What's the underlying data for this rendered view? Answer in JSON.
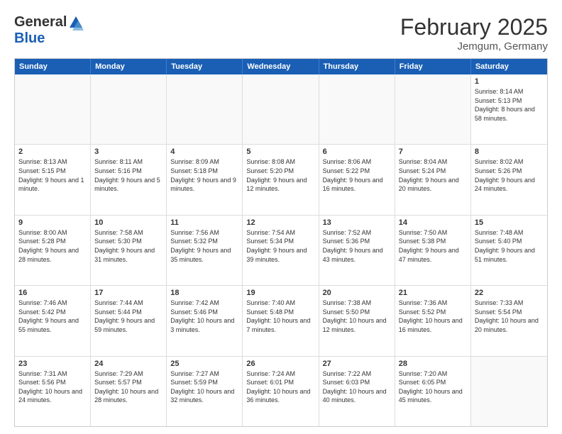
{
  "header": {
    "logo_general": "General",
    "logo_blue": "Blue",
    "month_title": "February 2025",
    "location": "Jemgum, Germany"
  },
  "days_of_week": [
    "Sunday",
    "Monday",
    "Tuesday",
    "Wednesday",
    "Thursday",
    "Friday",
    "Saturday"
  ],
  "weeks": [
    {
      "cells": [
        {
          "day": null,
          "content": ""
        },
        {
          "day": null,
          "content": ""
        },
        {
          "day": null,
          "content": ""
        },
        {
          "day": null,
          "content": ""
        },
        {
          "day": null,
          "content": ""
        },
        {
          "day": null,
          "content": ""
        },
        {
          "day": "1",
          "content": "Sunrise: 8:14 AM\nSunset: 5:13 PM\nDaylight: 8 hours and 58 minutes."
        }
      ]
    },
    {
      "cells": [
        {
          "day": "2",
          "content": "Sunrise: 8:13 AM\nSunset: 5:15 PM\nDaylight: 9 hours and 1 minute."
        },
        {
          "day": "3",
          "content": "Sunrise: 8:11 AM\nSunset: 5:16 PM\nDaylight: 9 hours and 5 minutes."
        },
        {
          "day": "4",
          "content": "Sunrise: 8:09 AM\nSunset: 5:18 PM\nDaylight: 9 hours and 9 minutes."
        },
        {
          "day": "5",
          "content": "Sunrise: 8:08 AM\nSunset: 5:20 PM\nDaylight: 9 hours and 12 minutes."
        },
        {
          "day": "6",
          "content": "Sunrise: 8:06 AM\nSunset: 5:22 PM\nDaylight: 9 hours and 16 minutes."
        },
        {
          "day": "7",
          "content": "Sunrise: 8:04 AM\nSunset: 5:24 PM\nDaylight: 9 hours and 20 minutes."
        },
        {
          "day": "8",
          "content": "Sunrise: 8:02 AM\nSunset: 5:26 PM\nDaylight: 9 hours and 24 minutes."
        }
      ]
    },
    {
      "cells": [
        {
          "day": "9",
          "content": "Sunrise: 8:00 AM\nSunset: 5:28 PM\nDaylight: 9 hours and 28 minutes."
        },
        {
          "day": "10",
          "content": "Sunrise: 7:58 AM\nSunset: 5:30 PM\nDaylight: 9 hours and 31 minutes."
        },
        {
          "day": "11",
          "content": "Sunrise: 7:56 AM\nSunset: 5:32 PM\nDaylight: 9 hours and 35 minutes."
        },
        {
          "day": "12",
          "content": "Sunrise: 7:54 AM\nSunset: 5:34 PM\nDaylight: 9 hours and 39 minutes."
        },
        {
          "day": "13",
          "content": "Sunrise: 7:52 AM\nSunset: 5:36 PM\nDaylight: 9 hours and 43 minutes."
        },
        {
          "day": "14",
          "content": "Sunrise: 7:50 AM\nSunset: 5:38 PM\nDaylight: 9 hours and 47 minutes."
        },
        {
          "day": "15",
          "content": "Sunrise: 7:48 AM\nSunset: 5:40 PM\nDaylight: 9 hours and 51 minutes."
        }
      ]
    },
    {
      "cells": [
        {
          "day": "16",
          "content": "Sunrise: 7:46 AM\nSunset: 5:42 PM\nDaylight: 9 hours and 55 minutes."
        },
        {
          "day": "17",
          "content": "Sunrise: 7:44 AM\nSunset: 5:44 PM\nDaylight: 9 hours and 59 minutes."
        },
        {
          "day": "18",
          "content": "Sunrise: 7:42 AM\nSunset: 5:46 PM\nDaylight: 10 hours and 3 minutes."
        },
        {
          "day": "19",
          "content": "Sunrise: 7:40 AM\nSunset: 5:48 PM\nDaylight: 10 hours and 7 minutes."
        },
        {
          "day": "20",
          "content": "Sunrise: 7:38 AM\nSunset: 5:50 PM\nDaylight: 10 hours and 12 minutes."
        },
        {
          "day": "21",
          "content": "Sunrise: 7:36 AM\nSunset: 5:52 PM\nDaylight: 10 hours and 16 minutes."
        },
        {
          "day": "22",
          "content": "Sunrise: 7:33 AM\nSunset: 5:54 PM\nDaylight: 10 hours and 20 minutes."
        }
      ]
    },
    {
      "cells": [
        {
          "day": "23",
          "content": "Sunrise: 7:31 AM\nSunset: 5:56 PM\nDaylight: 10 hours and 24 minutes."
        },
        {
          "day": "24",
          "content": "Sunrise: 7:29 AM\nSunset: 5:57 PM\nDaylight: 10 hours and 28 minutes."
        },
        {
          "day": "25",
          "content": "Sunrise: 7:27 AM\nSunset: 5:59 PM\nDaylight: 10 hours and 32 minutes."
        },
        {
          "day": "26",
          "content": "Sunrise: 7:24 AM\nSunset: 6:01 PM\nDaylight: 10 hours and 36 minutes."
        },
        {
          "day": "27",
          "content": "Sunrise: 7:22 AM\nSunset: 6:03 PM\nDaylight: 10 hours and 40 minutes."
        },
        {
          "day": "28",
          "content": "Sunrise: 7:20 AM\nSunset: 6:05 PM\nDaylight: 10 hours and 45 minutes."
        },
        {
          "day": null,
          "content": ""
        }
      ]
    }
  ]
}
